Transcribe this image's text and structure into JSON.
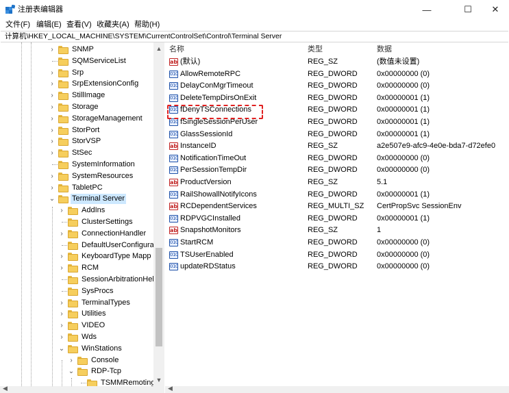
{
  "window": {
    "title": "注册表编辑器",
    "minimize_glyph": "—",
    "maximize_glyph": "☐",
    "close_glyph": "✕"
  },
  "menu": [
    "文件(F)",
    "编辑(E)",
    "查看(V)",
    "收藏夹(A)",
    "帮助(H)"
  ],
  "address": "计算机\\HKEY_LOCAL_MACHINE\\SYSTEM\\CurrentControlSet\\Control\\Terminal Server",
  "tree": [
    {
      "label": "SNMP",
      "level": 0,
      "expander": "collapsed"
    },
    {
      "label": "SQMServiceList",
      "level": 0,
      "expander": "none"
    },
    {
      "label": "Srp",
      "level": 0,
      "expander": "collapsed"
    },
    {
      "label": "SrpExtensionConfig",
      "level": 0,
      "expander": "collapsed"
    },
    {
      "label": "StillImage",
      "level": 0,
      "expander": "collapsed"
    },
    {
      "label": "Storage",
      "level": 0,
      "expander": "collapsed"
    },
    {
      "label": "StorageManagement",
      "level": 0,
      "expander": "collapsed"
    },
    {
      "label": "StorPort",
      "level": 0,
      "expander": "collapsed"
    },
    {
      "label": "StorVSP",
      "level": 0,
      "expander": "collapsed"
    },
    {
      "label": "StSec",
      "level": 0,
      "expander": "collapsed"
    },
    {
      "label": "SystemInformation",
      "level": 0,
      "expander": "none"
    },
    {
      "label": "SystemResources",
      "level": 0,
      "expander": "collapsed"
    },
    {
      "label": "TabletPC",
      "level": 0,
      "expander": "collapsed"
    },
    {
      "label": "Terminal Server",
      "level": 0,
      "expander": "expanded",
      "selected": true
    },
    {
      "label": "AddIns",
      "level": 1,
      "expander": "collapsed"
    },
    {
      "label": "ClusterSettings",
      "level": 1,
      "expander": "none"
    },
    {
      "label": "ConnectionHandler",
      "level": 1,
      "expander": "collapsed"
    },
    {
      "label": "DefaultUserConfigura",
      "level": 1,
      "expander": "none"
    },
    {
      "label": "KeyboardType Mapp",
      "level": 1,
      "expander": "collapsed"
    },
    {
      "label": "RCM",
      "level": 1,
      "expander": "collapsed"
    },
    {
      "label": "SessionArbitrationHel",
      "level": 1,
      "expander": "none"
    },
    {
      "label": "SysProcs",
      "level": 1,
      "expander": "none"
    },
    {
      "label": "TerminalTypes",
      "level": 1,
      "expander": "collapsed"
    },
    {
      "label": "Utilities",
      "level": 1,
      "expander": "collapsed"
    },
    {
      "label": "VIDEO",
      "level": 1,
      "expander": "collapsed"
    },
    {
      "label": "Wds",
      "level": 1,
      "expander": "collapsed"
    },
    {
      "label": "WinStations",
      "level": 1,
      "expander": "expanded"
    },
    {
      "label": "Console",
      "level": 2,
      "expander": "collapsed"
    },
    {
      "label": "RDP-Tcp",
      "level": 2,
      "expander": "expanded"
    },
    {
      "label": "TSMMRemoting",
      "level": 3,
      "expander": "none"
    }
  ],
  "list": {
    "columns": {
      "name": "名称",
      "type": "类型",
      "data": "数据"
    },
    "rows": [
      {
        "icon": "sz",
        "name": "(默认)",
        "type": "REG_SZ",
        "data": "(数值未设置)"
      },
      {
        "icon": "dw",
        "name": "AllowRemoteRPC",
        "type": "REG_DWORD",
        "data": "0x00000000 (0)"
      },
      {
        "icon": "dw",
        "name": "DelayConMgrTimeout",
        "type": "REG_DWORD",
        "data": "0x00000000 (0)"
      },
      {
        "icon": "dw",
        "name": "DeleteTempDirsOnExit",
        "type": "REG_DWORD",
        "data": "0x00000001 (1)"
      },
      {
        "icon": "dw",
        "name": "fDenyTSConnections",
        "type": "REG_DWORD",
        "data": "0x00000001 (1)"
      },
      {
        "icon": "dw",
        "name": "fSingleSessionPerUser",
        "type": "REG_DWORD",
        "data": "0x00000001 (1)"
      },
      {
        "icon": "dw",
        "name": "GlassSessionId",
        "type": "REG_DWORD",
        "data": "0x00000001 (1)"
      },
      {
        "icon": "sz",
        "name": "InstanceID",
        "type": "REG_SZ",
        "data": "a2e507e9-afc9-4e0e-bda7-d72efe0"
      },
      {
        "icon": "dw",
        "name": "NotificationTimeOut",
        "type": "REG_DWORD",
        "data": "0x00000000 (0)"
      },
      {
        "icon": "dw",
        "name": "PerSessionTempDir",
        "type": "REG_DWORD",
        "data": "0x00000000 (0)"
      },
      {
        "icon": "sz",
        "name": "ProductVersion",
        "type": "REG_SZ",
        "data": "5.1"
      },
      {
        "icon": "dw",
        "name": "RailShowallNotifyIcons",
        "type": "REG_DWORD",
        "data": "0x00000001 (1)"
      },
      {
        "icon": "sz",
        "name": "RCDependentServices",
        "type": "REG_MULTI_SZ",
        "data": "CertPropSvc SessionEnv"
      },
      {
        "icon": "dw",
        "name": "RDPVGCInstalled",
        "type": "REG_DWORD",
        "data": "0x00000001 (1)"
      },
      {
        "icon": "sz",
        "name": "SnapshotMonitors",
        "type": "REG_SZ",
        "data": "1"
      },
      {
        "icon": "dw",
        "name": "StartRCM",
        "type": "REG_DWORD",
        "data": "0x00000000 (0)"
      },
      {
        "icon": "dw",
        "name": "TSUserEnabled",
        "type": "REG_DWORD",
        "data": "0x00000000 (0)"
      },
      {
        "icon": "dw",
        "name": "updateRDStatus",
        "type": "REG_DWORD",
        "data": "0x00000000 (0)"
      }
    ]
  },
  "icons": {
    "string_value": "ab",
    "dword_value": "010"
  },
  "colors": {
    "highlight_border": "#e02020",
    "selection": "#cde8ff",
    "folder": "#f6ce5d"
  }
}
